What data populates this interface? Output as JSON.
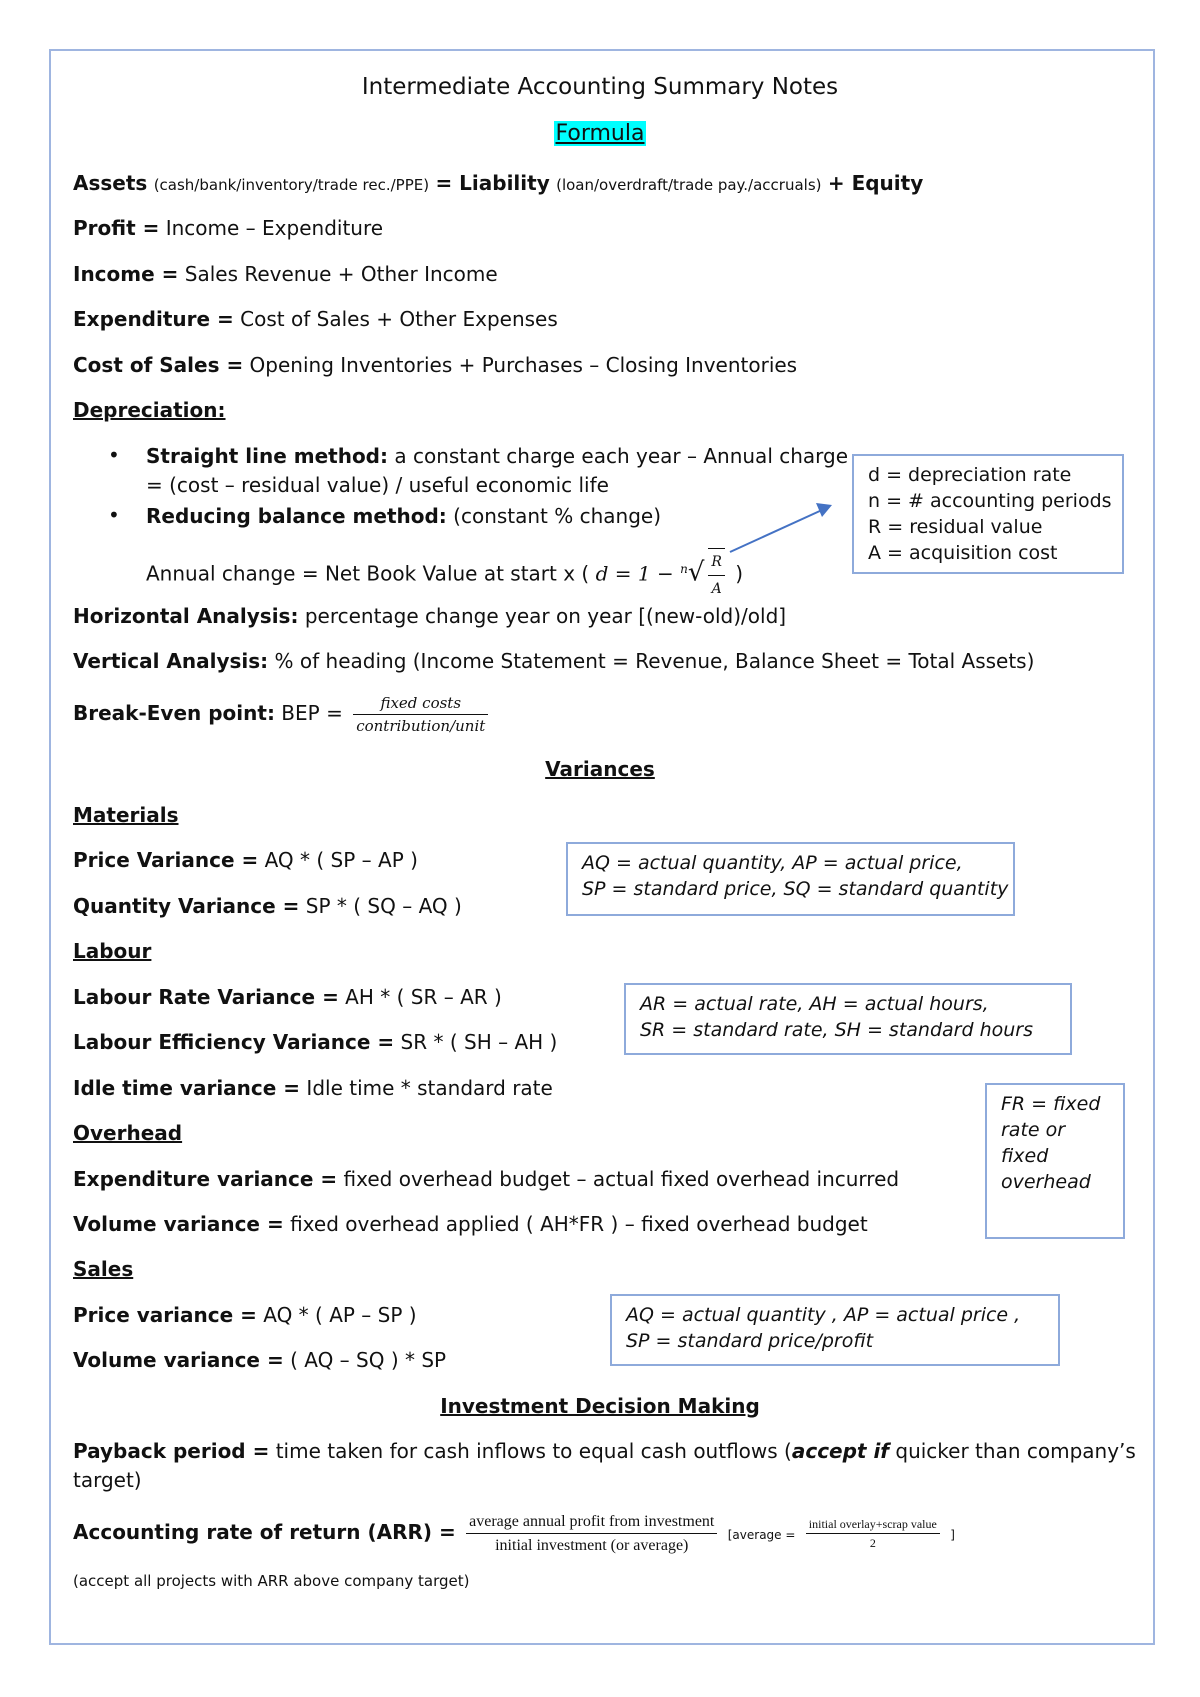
{
  "title": "Intermediate Accounting Summary Notes",
  "formula_heading": "Formula",
  "accent_highlight": "#00ffff",
  "box_border_color": "#8eaadb",
  "arrow_color": "#4472c4",
  "assets": {
    "label": "Assets",
    "assets_note": "(cash/bank/inventory/trade rec./PPE)",
    "eq": "= Liability",
    "liability_note": "(loan/overdraft/trade pay./accruals)",
    "equity": "+ Equity"
  },
  "formulas": [
    {
      "label": "Profit =",
      "text": " Income – Expenditure"
    },
    {
      "label": "Income =",
      "text": " Sales Revenue + Other Income"
    },
    {
      "label": "Expenditure =",
      "text": " Cost of Sales + Other Expenses"
    },
    {
      "label": "Cost of Sales =",
      "text": " Opening Inventories + Purchases – Closing Inventories"
    }
  ],
  "depreciation": {
    "heading": "Depreciation:",
    "straight_label": "Straight line method:",
    "straight_text": " a constant charge each year – Annual charge",
    "straight_text2": "= (cost – residual value) / useful economic life",
    "reducing_label": "Reducing balance method:",
    "reducing_text": " (constant % change)",
    "annual_change": "Annual change = Net Book Value at start x (",
    "formula_d": "d = 1 −",
    "root_index": "n",
    "root_num": "R",
    "root_den": "A",
    "close": ")",
    "legend": [
      "d = depreciation rate",
      "n = # accounting periods",
      "R = residual value",
      "A = acquisition cost"
    ]
  },
  "analysis": {
    "horizontal_label": "Horizontal Analysis:",
    "horizontal_text": " percentage change year on year [(new-old)/old]",
    "vertical_label": "Vertical Analysis:",
    "vertical_text": " % of heading (Income Statement = Revenue, Balance Sheet = Total Assets)",
    "bep_label": "Break-Even point:",
    "bep_text": " BEP =",
    "bep_num": "fixed costs",
    "bep_den": "contribution/unit"
  },
  "variances": {
    "heading": "Variances",
    "materials": {
      "heading": "Materials",
      "price_label": "Price Variance =",
      "price_text": " AQ * ( SP – AP )",
      "qty_label": "Quantity Variance =",
      "qty_text": " SP * ( SQ – AQ )",
      "box": [
        "AQ = actual quantity, AP = actual price,",
        "SP = standard price, SQ = standard quantity"
      ]
    },
    "labour": {
      "heading": "Labour",
      "rate_label": "Labour Rate Variance =",
      "rate_text": " AH * ( SR – AR )",
      "eff_label": "Labour Efficiency Variance =",
      "eff_text": " SR * ( SH – AH )",
      "idle_label": "Idle time variance =",
      "idle_text": " Idle time * standard rate",
      "box": [
        "AR = actual rate, AH = actual hours,",
        "SR = standard rate, SH = standard hours"
      ]
    },
    "overhead": {
      "heading": "Overhead",
      "exp_label": "Expenditure variance =",
      "exp_text": " fixed overhead budget – actual fixed overhead incurred",
      "vol_label": "Volume variance =",
      "vol_text": " fixed overhead applied ( AH*FR ) – fixed overhead budget",
      "box": [
        "FR = fixed",
        "rate or",
        "fixed",
        "overhead"
      ]
    },
    "sales": {
      "heading": "Sales",
      "price_label": "Price variance =",
      "price_text": " AQ * ( AP – SP )",
      "vol_label": "Volume variance =",
      "vol_text": " ( AQ – SQ ) * SP",
      "box": [
        "AQ = actual quantity , AP = actual price ,",
        "SP = standard price/profit"
      ]
    }
  },
  "investment": {
    "heading": "Investment Decision Making",
    "payback_label": "Payback period =",
    "payback_text": " time taken for cash inflows to equal cash outflows (",
    "payback_accept": "accept if",
    "payback_text2": " quicker than company’s",
    "payback_text3": "target)",
    "arr_label": "Accounting rate of return (ARR) =",
    "arr_num": "average annual profit from investment",
    "arr_den": "initial investment (or average)",
    "avg_open": "[average =",
    "avg_num": "initial overlay+scrap value",
    "avg_den": "2",
    "avg_close": "]",
    "arr_note": "(accept all projects with ARR above company target)"
  }
}
